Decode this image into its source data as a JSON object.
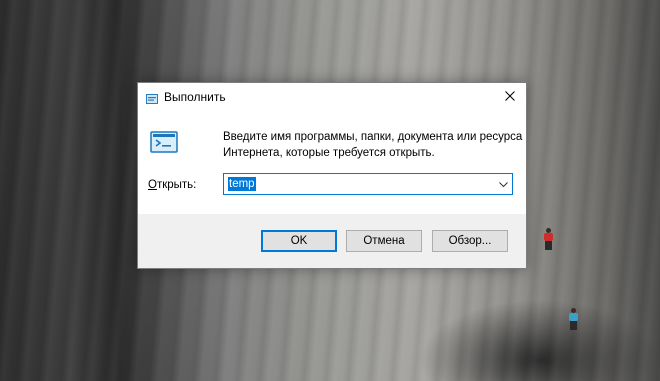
{
  "window": {
    "title": "Выполнить",
    "description_line1": "Введите имя программы, папки, документа или ресурса",
    "description_line2": "Интернета, которые требуется открыть.",
    "open_label_underlined": "О",
    "open_label_rest": "ткрыть:",
    "command_value": "temp"
  },
  "buttons": {
    "ok": "OK",
    "cancel": "Отмена",
    "browse": "Обзор..."
  },
  "colors": {
    "accent": "#0078d7",
    "footer_bg": "#f0f0f0",
    "button_bg": "#e1e1e1"
  },
  "icons": [
    "run-icon",
    "close-icon",
    "chevron-down-icon"
  ]
}
